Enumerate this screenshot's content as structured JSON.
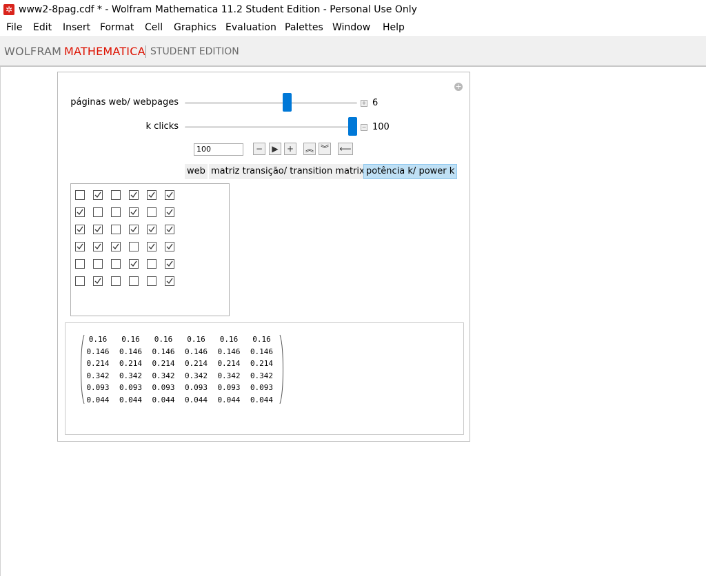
{
  "window": {
    "title": "www2-8pag.cdf * - Wolfram Mathematica 11.2 Student Edition - Personal Use Only"
  },
  "menu": [
    "File",
    "Edit",
    "Insert",
    "Format",
    "Cell",
    "Graphics",
    "Evaluation",
    "Palettes",
    "Window",
    "Help"
  ],
  "brand": {
    "wolfram": "WOLFRAM",
    "mathematica": "MATHEMATICA",
    "edition": "STUDENT EDITION"
  },
  "controls": {
    "pages_label": "páginas web/ webpages",
    "pages_value": "6",
    "pages_fraction": 0.6,
    "clicks_label": "k clicks",
    "clicks_value": "100",
    "clicks_fraction": 1.0,
    "anim_input_value": "100"
  },
  "tabs": [
    "web",
    "matriz transição/ transition matrix",
    "potência k/ power k"
  ],
  "active_tab": 2,
  "checkbox_grid": [
    [
      false,
      true,
      false,
      true,
      true,
      true
    ],
    [
      true,
      false,
      false,
      true,
      false,
      true
    ],
    [
      true,
      true,
      false,
      true,
      true,
      true
    ],
    [
      true,
      true,
      true,
      false,
      true,
      true
    ],
    [
      false,
      false,
      false,
      true,
      false,
      true
    ],
    [
      false,
      true,
      false,
      false,
      false,
      true
    ]
  ],
  "matrix": [
    [
      "0.16",
      "0.16",
      "0.16",
      "0.16",
      "0.16",
      "0.16"
    ],
    [
      "0.146",
      "0.146",
      "0.146",
      "0.146",
      "0.146",
      "0.146"
    ],
    [
      "0.214",
      "0.214",
      "0.214",
      "0.214",
      "0.214",
      "0.214"
    ],
    [
      "0.342",
      "0.342",
      "0.342",
      "0.342",
      "0.342",
      "0.342"
    ],
    [
      "0.093",
      "0.093",
      "0.093",
      "0.093",
      "0.093",
      "0.093"
    ],
    [
      "0.044",
      "0.044",
      "0.044",
      "0.044",
      "0.044",
      "0.044"
    ]
  ],
  "colors": {
    "accent": "#0078d7",
    "brand_red": "#dd1100",
    "active_tab": "#bfe0f5"
  }
}
